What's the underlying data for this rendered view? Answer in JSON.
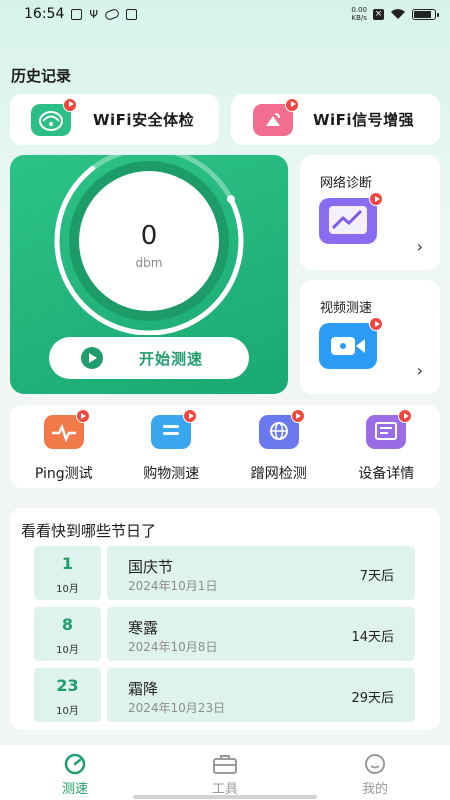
{
  "status_bar": {
    "time": "16:54",
    "net_speed_value": "0.00",
    "net_speed_unit": "KB/s",
    "battery_level": 0.9
  },
  "history": {
    "title": "历史记录",
    "items": [
      {
        "label": "WiFi安全体检",
        "icon": "wifi-shield-icon",
        "color": "#2cbf85"
      },
      {
        "label": "WiFi信号增强",
        "icon": "signal-boost-icon",
        "color": "#f26d8f"
      }
    ]
  },
  "speed_test": {
    "value": "0",
    "unit": "dbm",
    "progress": 0.72,
    "start_label": "开始测速"
  },
  "side_cards": [
    {
      "title": "网络诊断",
      "icon": "chart-trend-icon",
      "color": "#8a6cf0",
      "arrow": "›"
    },
    {
      "title": "视频测速",
      "icon": "video-camera-icon",
      "color": "#2a9cf5",
      "arrow": "›"
    }
  ],
  "tools": [
    {
      "label": "Ping测试",
      "icon": "pulse-icon",
      "color": "#f27a4a"
    },
    {
      "label": "购物测速",
      "icon": "cart-icon",
      "color": "#3aa6ee"
    },
    {
      "label": "蹭网检测",
      "icon": "shield-globe-icon",
      "color": "#6b79ee"
    },
    {
      "label": "设备详情",
      "icon": "device-info-icon",
      "color": "#9a6ce6"
    }
  ],
  "holidays": {
    "title": "看看快到哪些节日了",
    "items": [
      {
        "day": "1",
        "month": "10月",
        "name": "国庆节",
        "date": "2024年10月1日",
        "remain": "7天后"
      },
      {
        "day": "8",
        "month": "10月",
        "name": "寒露",
        "date": "2024年10月8日",
        "remain": "14天后"
      },
      {
        "day": "23",
        "month": "10月",
        "name": "霜降",
        "date": "2024年10月23日",
        "remain": "29天后"
      }
    ]
  },
  "nav": {
    "items": [
      {
        "label": "测速",
        "icon": "speedometer-icon",
        "active": true
      },
      {
        "label": "工具",
        "icon": "toolbox-icon",
        "active": false
      },
      {
        "label": "我的",
        "icon": "profile-smile-icon",
        "active": false
      }
    ]
  },
  "colors": {
    "accent": "#1f9e6b",
    "panel": "#23b67c",
    "holiday_bg": "#dff3ee"
  }
}
